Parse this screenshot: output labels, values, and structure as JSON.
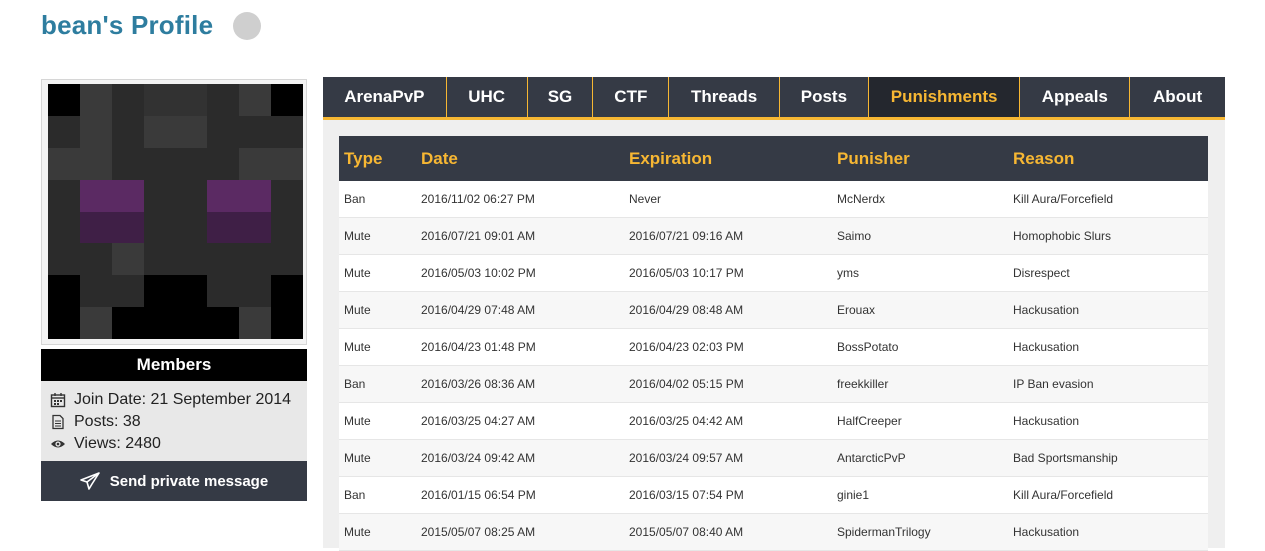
{
  "profile": {
    "title": "bean's Profile",
    "rank": "Members",
    "join_date": "Join Date: 21 September 2014",
    "posts": "Posts: 38",
    "views": "Views: 2480",
    "pm_label": "Send private message"
  },
  "colors": {
    "accent": "#f7b733",
    "header_bg": "#353a45",
    "title": "#2e7d9f"
  },
  "tabs": [
    {
      "label": "ArenaPvP"
    },
    {
      "label": "UHC"
    },
    {
      "label": "SG"
    },
    {
      "label": "CTF"
    },
    {
      "label": "Threads"
    },
    {
      "label": "Posts"
    },
    {
      "label": "Punishments"
    },
    {
      "label": "Appeals"
    },
    {
      "label": "About"
    }
  ],
  "active_tab": "Punishments",
  "table": {
    "headers": [
      "Type",
      "Date",
      "Expiration",
      "Punisher",
      "Reason"
    ],
    "rows": [
      [
        "Ban",
        "2016/11/02 06:27 PM",
        "Never",
        "McNerdx",
        "Kill Aura/Forcefield"
      ],
      [
        "Mute",
        "2016/07/21 09:01 AM",
        "2016/07/21 09:16 AM",
        "Saimo",
        "Homophobic Slurs"
      ],
      [
        "Mute",
        "2016/05/03 10:02 PM",
        "2016/05/03 10:17 PM",
        "yms",
        "Disrespect"
      ],
      [
        "Mute",
        "2016/04/29 07:48 AM",
        "2016/04/29 08:48 AM",
        "Erouax",
        "Hackusation"
      ],
      [
        "Mute",
        "2016/04/23 01:48 PM",
        "2016/04/23 02:03 PM",
        "BossPotato",
        "Hackusation"
      ],
      [
        "Ban",
        "2016/03/26 08:36 AM",
        "2016/04/02 05:15 PM",
        "freekkiller",
        "IP Ban evasion"
      ],
      [
        "Mute",
        "2016/03/25 04:27 AM",
        "2016/03/25 04:42 AM",
        "HalfCreeper",
        "Hackusation"
      ],
      [
        "Mute",
        "2016/03/24 09:42 AM",
        "2016/03/24 09:57 AM",
        "AntarcticPvP",
        "Bad Sportsmanship"
      ],
      [
        "Ban",
        "2016/01/15 06:54 PM",
        "2016/03/15 07:54 PM",
        "ginie1",
        "Kill Aura/Forcefield"
      ],
      [
        "Mute",
        "2015/05/07 08:25 AM",
        "2015/05/07 08:40 AM",
        "SpidermanTrilogy",
        "Hackusation"
      ]
    ]
  }
}
